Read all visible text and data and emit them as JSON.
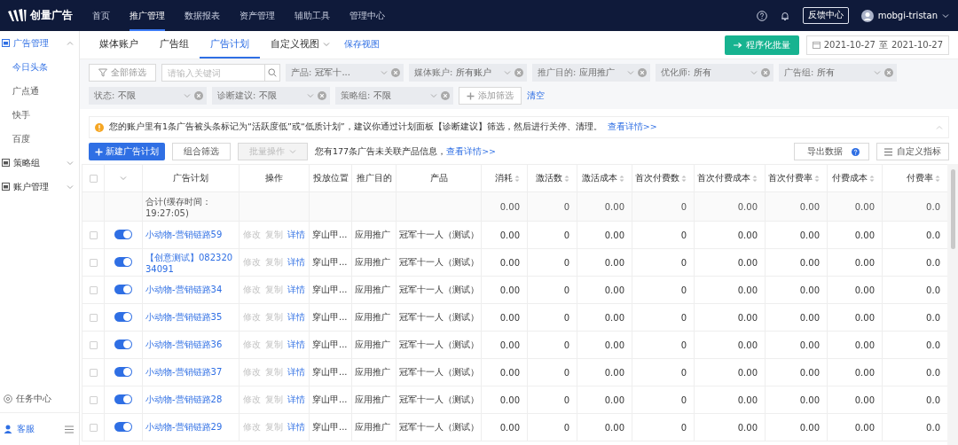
{
  "top_nav": {
    "logo": "创量广告",
    "items": [
      {
        "label": "首页",
        "selected": false
      },
      {
        "label": "推广管理",
        "selected": true
      },
      {
        "label": "数据报表",
        "selected": false
      },
      {
        "label": "资产管理",
        "selected": false
      },
      {
        "label": "辅助工具",
        "selected": false
      },
      {
        "label": "管理中心",
        "selected": false
      }
    ],
    "feedback": "反馈中心",
    "user": "mobgi-tristan"
  },
  "sidebar": {
    "groups": [
      {
        "label": "广告管理",
        "expanded": true,
        "children": [
          {
            "label": "今日头条",
            "selected": true
          },
          {
            "label": "广点通",
            "selected": false
          },
          {
            "label": "快手",
            "selected": false
          },
          {
            "label": "百度",
            "selected": false
          }
        ]
      },
      {
        "label": "策略组",
        "expanded": false
      },
      {
        "label": "账户管理",
        "expanded": false
      }
    ],
    "task_center": "任务中心",
    "support": "客服"
  },
  "view_tabs": {
    "tabs": [
      {
        "label": "媒体账户",
        "selected": false,
        "dropdown": false
      },
      {
        "label": "广告组",
        "selected": false,
        "dropdown": false
      },
      {
        "label": "广告计划",
        "selected": true,
        "dropdown": false
      },
      {
        "label": "自定义视图",
        "selected": false,
        "dropdown": true
      }
    ],
    "save_view": "保存视图",
    "batch_button": "程序化批量",
    "date_from": "2021-10-27",
    "date_sep": "至",
    "date_to": "2021-10-27"
  },
  "filters": {
    "all_filters": "全部筛选",
    "search_placeholder": "请输入关键词",
    "selects": [
      {
        "label": "产品:",
        "value": "冠军十..."
      },
      {
        "label": "媒体账户:",
        "value": "所有账户"
      },
      {
        "label": "推广目的:",
        "value": "应用推广"
      },
      {
        "label": "优化师:",
        "value": "所有"
      },
      {
        "label": "广告组:",
        "value": "所有"
      },
      {
        "label": "状态:",
        "value": "不限"
      },
      {
        "label": "诊断建议:",
        "value": "不限"
      },
      {
        "label": "策略组:",
        "value": "不限"
      }
    ],
    "add_filter": "添加筛选",
    "clear": "清空"
  },
  "notice": {
    "text": "您的账户里有1条广告被头条标记为“活跃度低”或“低质计划”，建议你通过计划面板【诊断建议】筛选，然后进行关停、清理。",
    "link": "查看详情>>"
  },
  "toolbar": {
    "new_button": "新建广告计划",
    "combo_filter": "组合筛选",
    "batch_ops": {
      "label": "批量操作",
      "disabled": true
    },
    "info": "您有177条广告未关联产品信息，",
    "info_link": "查看详情>>",
    "export": "导出数据",
    "custom_metrics": "自定义指标"
  },
  "table": {
    "header_checked": false,
    "columns": [
      {
        "label": "广告计划",
        "sortable": false
      },
      {
        "label": "操作",
        "sortable": false
      },
      {
        "label": "投放位置",
        "sortable": false
      },
      {
        "label": "推广目的",
        "sortable": false
      },
      {
        "label": "产品",
        "sortable": false
      },
      {
        "label": "消耗",
        "sortable": true
      },
      {
        "label": "激活数",
        "sortable": true
      },
      {
        "label": "激活成本",
        "sortable": true
      },
      {
        "label": "首次付费数",
        "sortable": true
      },
      {
        "label": "首次付费成本",
        "sortable": true
      },
      {
        "label": "首次付费率",
        "sortable": true
      },
      {
        "label": "付费成本",
        "sortable": true
      },
      {
        "label": "付费率",
        "sortable": true
      }
    ],
    "total": {
      "label": "合计(缓存时间：19:27:05)",
      "values": [
        "0.00",
        "0",
        "0.00",
        "0",
        "0.00",
        "0.00",
        "0.00",
        "0.0"
      ]
    },
    "rows": [
      {
        "checked": false,
        "enabled": true,
        "name": "小动物-营销链路59",
        "actions": [
          {
            "label": "修改",
            "disabled": true
          },
          {
            "label": "复制",
            "disabled": true
          },
          {
            "label": "详情",
            "disabled": false
          }
        ],
        "placement": "穿山甲...",
        "purpose": "应用推广",
        "product": "冠军十一人（测试）",
        "values": [
          "0.00",
          "0",
          "0.00",
          "0",
          "0.00",
          "0.00",
          "0.00",
          "0.0"
        ]
      },
      {
        "checked": false,
        "enabled": true,
        "name": "【创意测试】08232034091",
        "actions": [
          {
            "label": "修改",
            "disabled": true
          },
          {
            "label": "复制",
            "disabled": true
          },
          {
            "label": "详情",
            "disabled": false
          }
        ],
        "placement": "穿山甲...",
        "purpose": "应用推广",
        "product": "冠军十一人（测试）",
        "values": [
          "0.00",
          "0",
          "0.00",
          "0",
          "0.00",
          "0.00",
          "0.00",
          "0.0"
        ]
      },
      {
        "checked": false,
        "enabled": true,
        "name": "小动物-营销链路34",
        "actions": [
          {
            "label": "修改",
            "disabled": true
          },
          {
            "label": "复制",
            "disabled": true
          },
          {
            "label": "详情",
            "disabled": false
          }
        ],
        "placement": "穿山甲...",
        "purpose": "应用推广",
        "product": "冠军十一人（测试）",
        "values": [
          "0.00",
          "0",
          "0.00",
          "0",
          "0.00",
          "0.00",
          "0.00",
          "0.0"
        ]
      },
      {
        "checked": false,
        "enabled": true,
        "name": "小动物-营销链路35",
        "actions": [
          {
            "label": "修改",
            "disabled": true
          },
          {
            "label": "复制",
            "disabled": true
          },
          {
            "label": "详情",
            "disabled": false
          }
        ],
        "placement": "穿山甲...",
        "purpose": "应用推广",
        "product": "冠军十一人（测试）",
        "values": [
          "0.00",
          "0",
          "0.00",
          "0",
          "0.00",
          "0.00",
          "0.00",
          "0.0"
        ]
      },
      {
        "checked": false,
        "enabled": true,
        "name": "小动物-营销链路36",
        "actions": [
          {
            "label": "修改",
            "disabled": true
          },
          {
            "label": "复制",
            "disabled": true
          },
          {
            "label": "详情",
            "disabled": false
          }
        ],
        "placement": "穿山甲...",
        "purpose": "应用推广",
        "product": "冠军十一人（测试）",
        "values": [
          "0.00",
          "0",
          "0.00",
          "0",
          "0.00",
          "0.00",
          "0.00",
          "0.0"
        ]
      },
      {
        "checked": false,
        "enabled": true,
        "name": "小动物-营销链路37",
        "actions": [
          {
            "label": "修改",
            "disabled": true
          },
          {
            "label": "复制",
            "disabled": true
          },
          {
            "label": "详情",
            "disabled": false
          }
        ],
        "placement": "穿山甲...",
        "purpose": "应用推广",
        "product": "冠军十一人（测试）",
        "values": [
          "0.00",
          "0",
          "0.00",
          "0",
          "0.00",
          "0.00",
          "0.00",
          "0.0"
        ]
      },
      {
        "checked": false,
        "enabled": true,
        "name": "小动物-营销链路28",
        "actions": [
          {
            "label": "修改",
            "disabled": true
          },
          {
            "label": "复制",
            "disabled": true
          },
          {
            "label": "详情",
            "disabled": false
          }
        ],
        "placement": "穿山甲...",
        "purpose": "应用推广",
        "product": "冠军十一人（测试）",
        "values": [
          "0.00",
          "0",
          "0.00",
          "0",
          "0.00",
          "0.00",
          "0.00",
          "0.0"
        ]
      },
      {
        "checked": false,
        "enabled": true,
        "name": "小动物-营销链路29",
        "actions": [
          {
            "label": "修改",
            "disabled": true
          },
          {
            "label": "复制",
            "disabled": true
          },
          {
            "label": "详情",
            "disabled": false
          }
        ],
        "placement": "穿山甲...",
        "purpose": "应用推广",
        "product": "冠军十一人（测试）",
        "values": [
          "0.00",
          "0",
          "0.00",
          "0",
          "0.00",
          "0.00",
          "0.00",
          "0.0"
        ]
      }
    ]
  }
}
